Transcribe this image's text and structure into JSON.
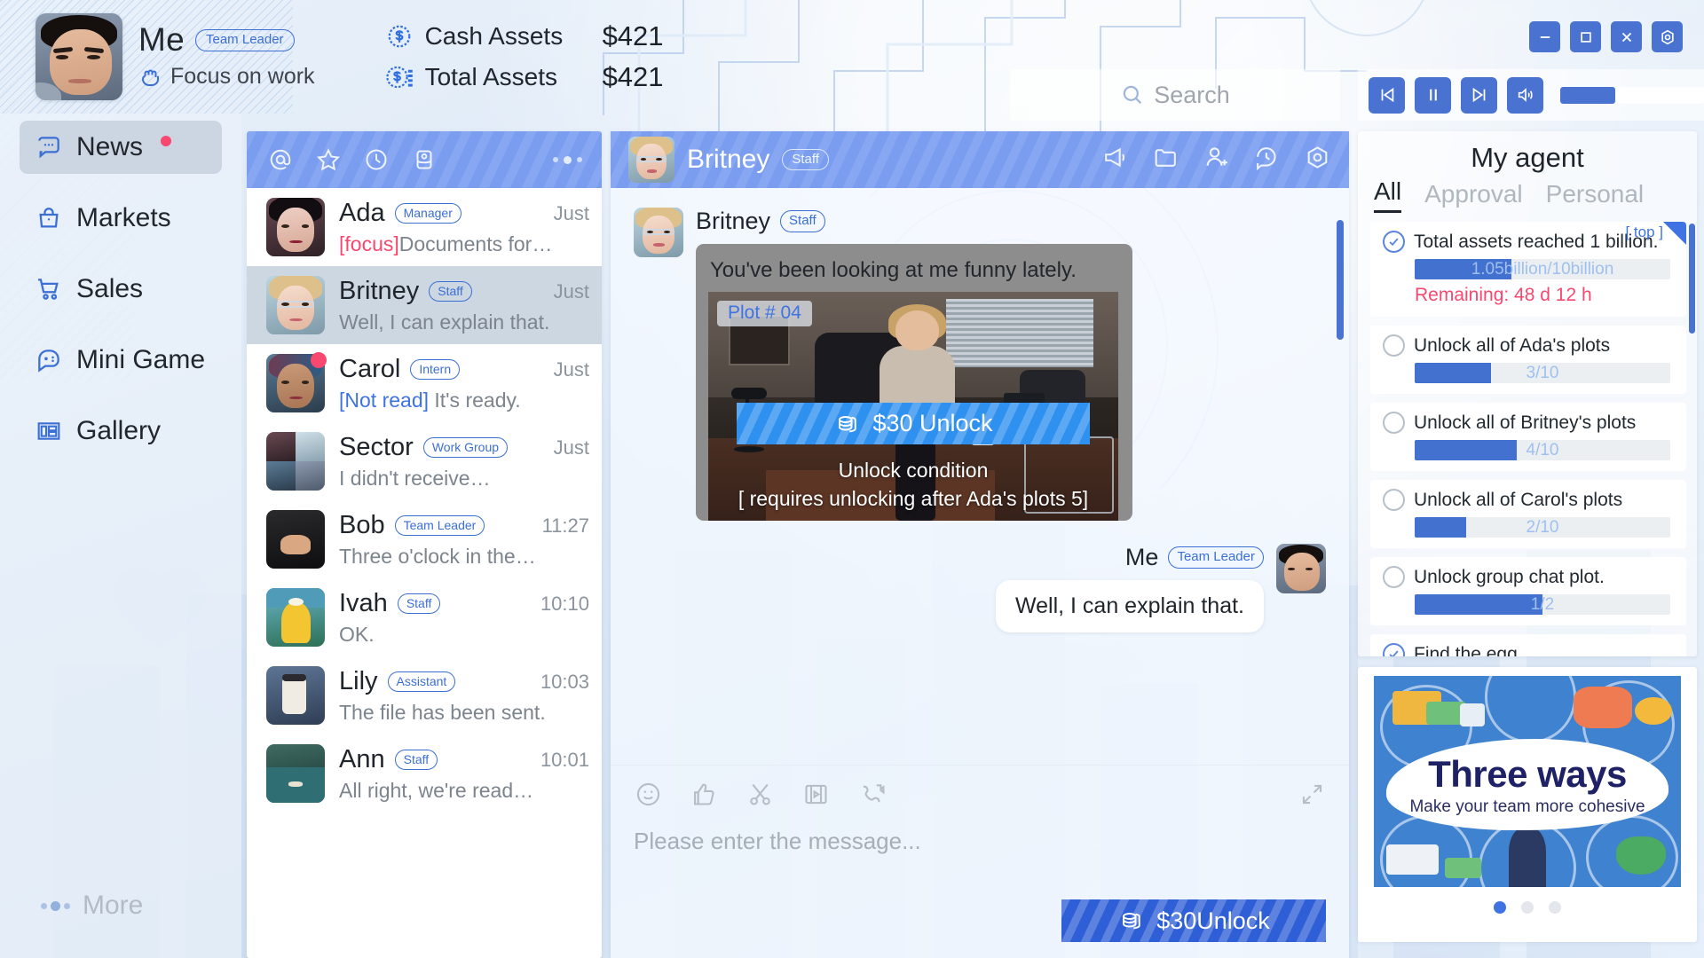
{
  "header": {
    "me_name": "Me",
    "me_role": "Team Leader",
    "status_icon": "fist-icon",
    "status_text": "Focus on work",
    "assets": [
      {
        "icon": "coin-icon",
        "label": "Cash Assets",
        "value": "$421"
      },
      {
        "icon": "coins-icon",
        "label": "Total Assets",
        "value": "$421"
      }
    ],
    "search_placeholder": "Search",
    "transport": [
      "prev-track-button",
      "pause-button",
      "next-track-button",
      "volume-button"
    ],
    "volume_percent": 38,
    "window_buttons": [
      "minimize-button",
      "maximize-button",
      "close-button",
      "settings-button"
    ]
  },
  "sidebar": {
    "items": [
      {
        "label": "News",
        "icon": "chat-bubble-icon",
        "active": true,
        "dot": true
      },
      {
        "label": "Markets",
        "icon": "shopping-bag-icon",
        "active": false,
        "dot": false
      },
      {
        "label": "Sales",
        "icon": "shopping-cart-icon",
        "active": false,
        "dot": false
      },
      {
        "label": "Mini Game",
        "icon": "gamepad-icon",
        "active": false,
        "dot": false
      },
      {
        "label": "Gallery",
        "icon": "gallery-grid-icon",
        "active": false,
        "dot": false
      }
    ],
    "more_label": "More"
  },
  "contacts": {
    "toolbar_icons": [
      "at-mention-icon",
      "star-icon",
      "clock-icon",
      "archive-icon",
      "more-icon"
    ],
    "items": [
      {
        "name": "Ada",
        "role": "Manager",
        "time": "Just",
        "tag": "[focus]",
        "tag_kind": "focus",
        "preview": "Documents for…",
        "selected": false,
        "unread": false
      },
      {
        "name": "Britney",
        "role": "Staff",
        "time": "Just",
        "tag": "",
        "tag_kind": "",
        "preview": "Well, I can explain that.",
        "selected": true,
        "unread": false
      },
      {
        "name": "Carol",
        "role": "Intern",
        "time": "Just",
        "tag": "[Not read]",
        "tag_kind": "unread",
        "preview": " It's ready.",
        "selected": false,
        "unread": true
      },
      {
        "name": "Sector",
        "role": "Work Group",
        "time": "Just",
        "tag": "",
        "tag_kind": "",
        "preview": "I didn't receive…",
        "selected": false,
        "unread": false
      },
      {
        "name": "Bob",
        "role": "Team Leader",
        "time": "11:27",
        "tag": "",
        "tag_kind": "",
        "preview": "Three o'clock in the…",
        "selected": false,
        "unread": false
      },
      {
        "name": "Ivah",
        "role": "Staff",
        "time": "10:10",
        "tag": "",
        "tag_kind": "",
        "preview": "OK.",
        "selected": false,
        "unread": false
      },
      {
        "name": "Lily",
        "role": "Assistant",
        "time": "10:03",
        "tag": "",
        "tag_kind": "",
        "preview": "The file has been sent.",
        "selected": false,
        "unread": false
      },
      {
        "name": "Ann",
        "role": "Staff",
        "time": "10:01",
        "tag": "",
        "tag_kind": "",
        "preview": "All right, we're read…",
        "selected": false,
        "unread": false
      }
    ]
  },
  "chat": {
    "title": "Britney",
    "title_role": "Staff",
    "header_icons": [
      "megaphone-icon",
      "folder-icon",
      "add-user-icon",
      "history-chat-icon",
      "record-icon"
    ],
    "incoming": {
      "name": "Britney",
      "role": "Staff",
      "text": "You've been looking at me funny lately.",
      "plot_tag": "Plot # 04",
      "unlock_label": "$30 Unlock",
      "condition_line1": "Unlock condition",
      "condition_line2": "[ requires unlocking after Ada's plots 5]"
    },
    "outgoing": {
      "name": "Me",
      "role": "Team Leader",
      "text": "Well, I can explain that."
    },
    "composer": {
      "icons": [
        "emoji-icon",
        "thumbs-up-icon",
        "scissors-icon",
        "video-clip-icon",
        "video-call-icon",
        "expand-icon"
      ],
      "placeholder": "Please enter the message...",
      "send_label": "$30Unlock"
    }
  },
  "agent": {
    "title": "My agent",
    "tabs": [
      {
        "label": "All",
        "active": true
      },
      {
        "label": "Approval",
        "active": false
      },
      {
        "label": "Personal",
        "active": false
      }
    ],
    "tasks": [
      {
        "label": "Total assets reached 1 billion.",
        "done": true,
        "progress_text": "1.05billion/10billion",
        "percent": 38,
        "remaining": "Remaining: 48 d 12 h",
        "corner": "[ top ]"
      },
      {
        "label": "Unlock all of Ada's plots",
        "done": false,
        "progress_text": "3/10",
        "percent": 30,
        "remaining": "",
        "corner": ""
      },
      {
        "label": "Unlock all of Britney's plots",
        "done": false,
        "progress_text": "4/10",
        "percent": 40,
        "remaining": "",
        "corner": ""
      },
      {
        "label": "Unlock all of Carol's plots",
        "done": false,
        "progress_text": "2/10",
        "percent": 20,
        "remaining": "",
        "corner": ""
      },
      {
        "label": "Unlock group chat plot.",
        "done": false,
        "progress_text": "1/2",
        "percent": 50,
        "remaining": "",
        "corner": ""
      },
      {
        "label": "Find the egg.",
        "done": true,
        "progress_text": "",
        "percent": 0,
        "remaining": "",
        "corner": ""
      }
    ]
  },
  "promo": {
    "headline": "Three ways",
    "subhead": "Make your team more cohesive",
    "dots": 3,
    "active_dot": 0
  },
  "colors": {
    "accent_blue": "#4a73d1",
    "header_blue": "#7a9df0",
    "unlock_blue": "#2e90ef",
    "send_blue": "#2f5fd6",
    "danger_pink": "#f8486f",
    "link_blue": "#3f73e3"
  }
}
